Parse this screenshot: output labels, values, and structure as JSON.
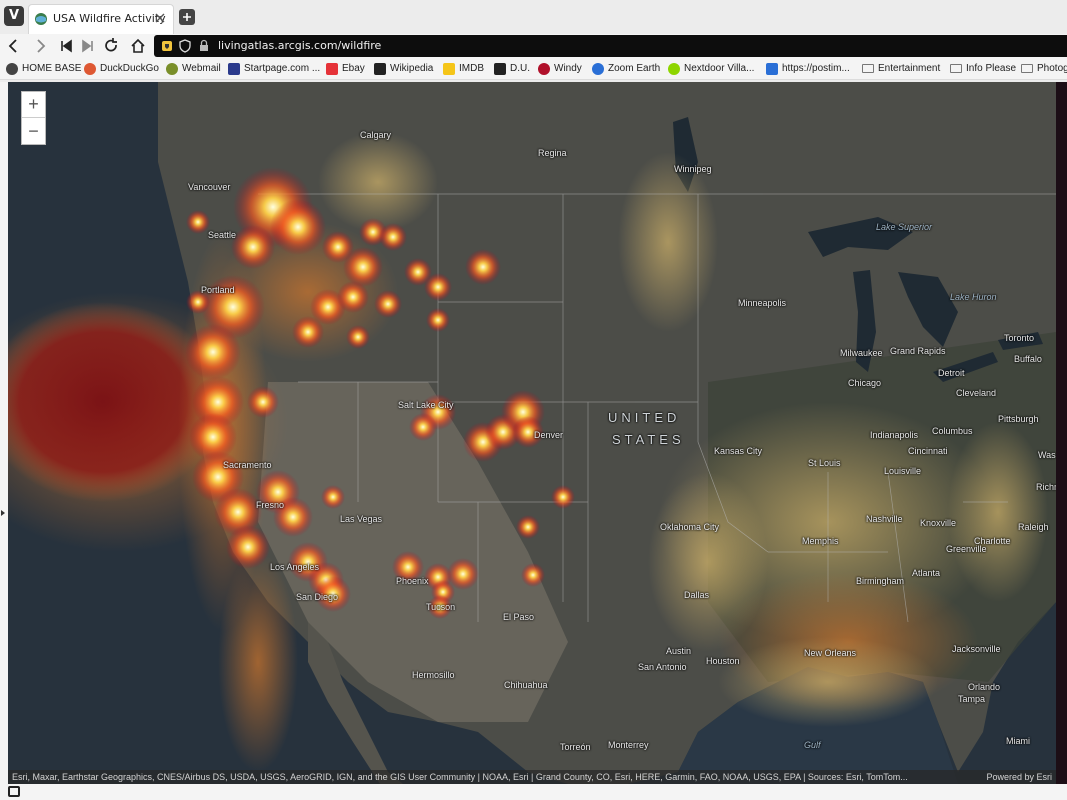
{
  "tab": {
    "title": "USA Wildfire Activity"
  },
  "nav": {
    "url": "livingatlas.arcgis.com/wildfire"
  },
  "bookmarks": [
    {
      "label": "HOME BASE",
      "color": "#444444"
    },
    {
      "label": "DuckDuckGo",
      "color": "#de5833"
    },
    {
      "label": "Webmail",
      "color": "#7a8f2a"
    },
    {
      "label": "Startpage.com ...",
      "color": "#2b3a8c"
    },
    {
      "label": "Ebay",
      "color": "#e53238"
    },
    {
      "label": "Wikipedia",
      "color": "#222222"
    },
    {
      "label": "IMDB",
      "color": "#f5c518"
    },
    {
      "label": "D.U.",
      "color": "#222222"
    },
    {
      "label": "Windy",
      "color": "#b0102a"
    },
    {
      "label": "Zoom Earth",
      "color": "#2a6fd6"
    },
    {
      "label": "Nextdoor Villa...",
      "color": "#8ed500"
    },
    {
      "label": "https://postim...",
      "color": "#2a6fd6"
    },
    {
      "label": "Entertainment",
      "color": "#777777"
    },
    {
      "label": "Info Please",
      "color": "#777777"
    },
    {
      "label": "Photog",
      "color": "#777777"
    }
  ],
  "map": {
    "zoom_in": "+",
    "zoom_out": "−",
    "country_label_1": "UNITED",
    "country_label_2": "STATES",
    "cities": {
      "vancouver": "Vancouver",
      "seattle": "Seattle",
      "portland": "Portland",
      "calgary": "Calgary",
      "regina": "Regina",
      "winnipeg": "Winnipeg",
      "minneapolis": "Minneapolis",
      "milwaukee": "Milwaukee",
      "grand_rapids": "Grand Rapids",
      "chicago": "Chicago",
      "detroit": "Detroit",
      "toronto": "Toronto",
      "buffalo": "Buffalo",
      "cleveland": "Cleveland",
      "pittsburgh": "Pittsburgh",
      "columbus": "Columbus",
      "indianapolis": "Indianapolis",
      "cincinnati": "Cincinnati",
      "louisville": "Louisville",
      "st_louis": "St Louis",
      "kansas_city": "Kansas City",
      "salt_lake": "Salt Lake City",
      "denver": "Denver",
      "sacramento": "Sacramento",
      "fresno": "Fresno",
      "las_vegas": "Las Vegas",
      "los_angeles": "Los Angeles",
      "san_diego": "San Diego",
      "phoenix": "Phoenix",
      "tucson": "Tucson",
      "el_paso": "El Paso",
      "oklahoma_city": "Oklahoma City",
      "dallas": "Dallas",
      "austin": "Austin",
      "houston": "Houston",
      "san_antonio": "San Antonio",
      "hermosillo": "Hermosillo",
      "chihuahua": "Chihuahua",
      "torreon": "Torreón",
      "monterrey": "Monterrey",
      "memphis": "Memphis",
      "nashville": "Nashville",
      "knoxville": "Knoxville",
      "greenville": "Greenville",
      "charlotte": "Charlotte",
      "raleigh": "Raleigh",
      "richmond": "Richm",
      "birmingham": "Birmingham",
      "atlanta": "Atlanta",
      "new_orleans": "New Orleans",
      "jacksonville": "Jacksonville",
      "orlando": "Orlando",
      "tampa": "Tampa",
      "miami": "Miami",
      "washington": "Was",
      "lake_superior": "Lake Superior",
      "lake_huron": "Lake Huron",
      "gulf": "Gulf"
    },
    "attribution": "Esri, Maxar, Earthstar Geographics, CNES/Airbus DS, USDA, USGS, AeroGRID, IGN, and the GIS User Community | NOAA, Esri | Grand County, CO, Esri, HERE, Garmin, FAO, NOAA, USGS, EPA | Sources: Esri, TomTom...",
    "powered_by": "Powered by Esri"
  }
}
